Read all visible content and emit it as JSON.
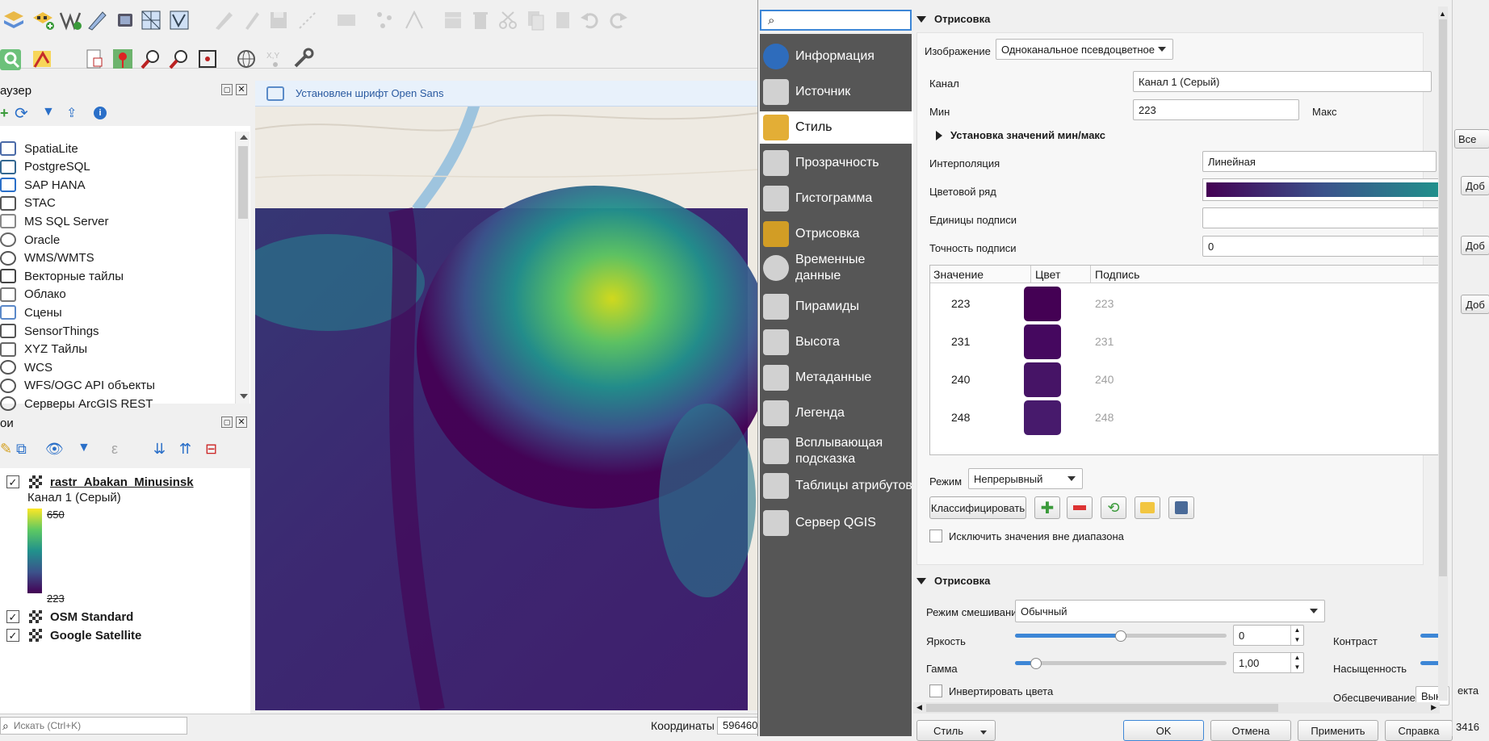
{
  "search": {
    "placeholder": "Искать (Ctrl+K)"
  },
  "message_bar": {
    "text": "Установлен шрифт Open Sans"
  },
  "browser": {
    "title": "аузер",
    "items": [
      {
        "label": "SpatiaLite",
        "icon": "feather-icon"
      },
      {
        "label": "PostgreSQL",
        "icon": "elephant-icon"
      },
      {
        "label": "SAP HANA",
        "icon": "database-icon"
      },
      {
        "label": "STAC",
        "icon": "stac-icon"
      },
      {
        "label": "MS SQL Server",
        "icon": "mssql-icon"
      },
      {
        "label": "Oracle",
        "icon": "oracle-icon"
      },
      {
        "label": "WMS/WMTS",
        "icon": "globe-icon"
      },
      {
        "label": "Векторные тайлы",
        "icon": "grid-icon"
      },
      {
        "label": "Облако",
        "icon": "cloud-icon"
      },
      {
        "label": "Сцены",
        "icon": "cube-icon"
      },
      {
        "label": "SensorThings",
        "icon": "sensor-icon"
      },
      {
        "label": "XYZ Тайлы",
        "icon": "tiles-icon"
      },
      {
        "label": "WCS",
        "icon": "globe-icon"
      },
      {
        "label": "WFS/OGC API объекты",
        "icon": "globe-icon"
      },
      {
        "label": "Серверы ArcGIS REST",
        "icon": "globe-icon"
      }
    ]
  },
  "layers": {
    "title": "ои",
    "items": [
      {
        "name": "rastr_Abakan_Minusinsk",
        "checked": true
      },
      {
        "name": "OSM Standard",
        "checked": true
      },
      {
        "name": "Google Satellite",
        "checked": true
      }
    ],
    "legend": {
      "band": "Канал 1 (Серый)",
      "max": "650",
      "min": "223"
    }
  },
  "status": {
    "coords_label": "Координаты",
    "coords_value": "596460",
    "right_value": "3416"
  },
  "props": {
    "search_placeholder": "",
    "nav": [
      {
        "label": "Информация",
        "icon": "info-icon"
      },
      {
        "label": "Источник",
        "icon": "source-icon"
      },
      {
        "label": "Стиль",
        "icon": "paintbrush-icon",
        "active": true
      },
      {
        "label": "Прозрачность",
        "icon": "transparency-icon"
      },
      {
        "label": "Гистограмма",
        "icon": "histogram-icon"
      },
      {
        "label": "Отрисовка",
        "icon": "brush-icon"
      },
      {
        "label": "Временные данные",
        "icon": "clock-icon"
      },
      {
        "label": "Пирамиды",
        "icon": "pyramid-icon"
      },
      {
        "label": "Высота",
        "icon": "elevation-icon"
      },
      {
        "label": "Метаданные",
        "icon": "metadata-icon"
      },
      {
        "label": "Легенда",
        "icon": "legend-icon"
      },
      {
        "label": "Всплывающая подсказка",
        "icon": "tooltip-icon"
      },
      {
        "label": "Таблицы атрибутов",
        "icon": "table-icon"
      },
      {
        "label": "Сервер QGIS",
        "icon": "server-icon"
      }
    ],
    "render_section": {
      "title": "Отрисовка",
      "image_label": "Изображение",
      "image_value": "Одноканальное псевдоцветное",
      "band_label": "Канал",
      "band_value": "Канал 1 (Серый)",
      "min_label": "Мин",
      "min_value": "223",
      "max_label": "Макс",
      "minmax_title": "Установка значений мин/макс",
      "interp_label": "Интерполяция",
      "interp_value": "Линейная",
      "ramp_label": "Цветовой ряд",
      "units_label": "Единицы подписи",
      "units_value": "",
      "precision_label": "Точность подписи",
      "precision_value": "0",
      "table_headers": [
        "Значение",
        "Цвет",
        "Подпись"
      ],
      "rows": [
        {
          "value": "223",
          "color": "#440154",
          "label": "223"
        },
        {
          "value": "231",
          "color": "#45085f",
          "label": "231"
        },
        {
          "value": "240",
          "color": "#461466",
          "label": "240"
        },
        {
          "value": "248",
          "color": "#471a6c",
          "label": "248"
        }
      ],
      "mode_label": "Режим",
      "mode_value": "Непрерывный",
      "classify_btn": "Классифицировать",
      "exclude_label": "Исключить значения вне диапазона"
    },
    "render2_section": {
      "title": "Отрисовка",
      "blend_label": "Режим смешивания",
      "blend_value": "Обычный",
      "brightness_label": "Яркость",
      "brightness_value": "0",
      "brightness_level": 0.5,
      "contrast_label": "Контраст",
      "gamma_label": "Гамма",
      "gamma_value": "1,00",
      "gamma_level": 0.1,
      "saturation_label": "Насыщенность",
      "invert_label": "Инвертировать цвета",
      "desaturate_label": "Обесцвечивание",
      "desaturate_value": "Выкл"
    },
    "footer": {
      "style": "Стиль",
      "ok": "OK",
      "cancel": "Отмена",
      "apply": "Применить",
      "help": "Справка"
    }
  },
  "right_edge": {
    "all_btn": "Все",
    "add1": "Доб",
    "add2": "Доб",
    "add3": "Доб",
    "ekta": "екта"
  },
  "colors": {
    "nav_bg": "#555555",
    "nav_active": "#ffffff",
    "accent": "#3d86d6",
    "viridis_dark": "#440154",
    "viridis_light": "#fde725"
  }
}
